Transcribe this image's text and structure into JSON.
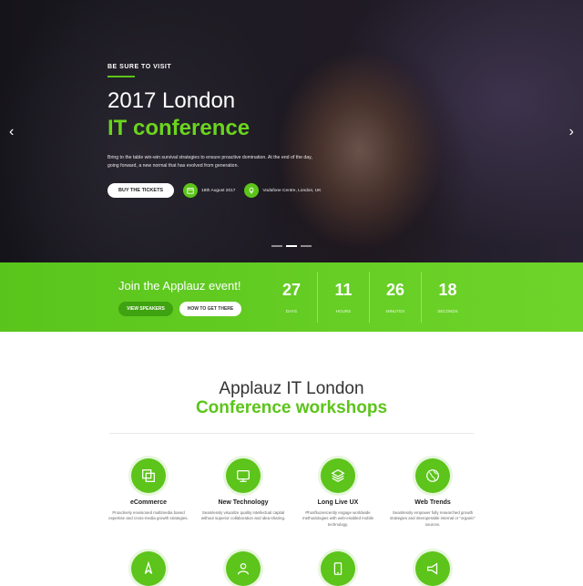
{
  "hero": {
    "eyebrow": "BE SURE TO VISIT",
    "title_line1": "2017 London",
    "title_line2": "IT conference",
    "description": "Bring to the table win-win survival strategies to ensure proactive domination. At the end of the day, going forward, a new normal that has evolved from generation.",
    "cta_label": "BUY THE TICKETS",
    "date": "18th August 2017",
    "venue": "Vodafone Centre, London, UK",
    "arrow_left": "‹",
    "arrow_right": "›"
  },
  "event_band": {
    "title": "Join the Applauz event!",
    "btn_speakers": "VIEW SPEAKERS",
    "btn_directions": "HOW TO GET THERE",
    "countdown": [
      {
        "value": "27",
        "label": "DAYS"
      },
      {
        "value": "11",
        "label": "HOURS"
      },
      {
        "value": "26",
        "label": "MINUTES"
      },
      {
        "value": "18",
        "label": "SECONDS"
      }
    ]
  },
  "workshops": {
    "title_line1": "Applauz IT London",
    "title_line2": "Conference workshops",
    "items": [
      {
        "title": "eCommerce",
        "description": "Proactively envisioned multimedia based expertise and cross-media growth strategies.",
        "icon": "squares-icon"
      },
      {
        "title": "New Technology",
        "description": "Seamlessly visualize quality intellectual capital without superior collaboration and idea-sharing.",
        "icon": "monitor-icon"
      },
      {
        "title": "Long Live UX",
        "description": "Phosfluorescently engage worldwide methodologies with web-enabled mobile technology.",
        "icon": "layers-icon"
      },
      {
        "title": "Web Trends",
        "description": "Seamlessly empower fully researched growth strategies and interoperable internal or \"organic\" sources.",
        "icon": "globe-icon"
      }
    ],
    "row2_icons": [
      "cursor-icon",
      "users-icon",
      "mobile-icon",
      "megaphone-icon"
    ]
  },
  "colors": {
    "accent": "#5cc41a",
    "accent_dark": "#3fa210"
  }
}
